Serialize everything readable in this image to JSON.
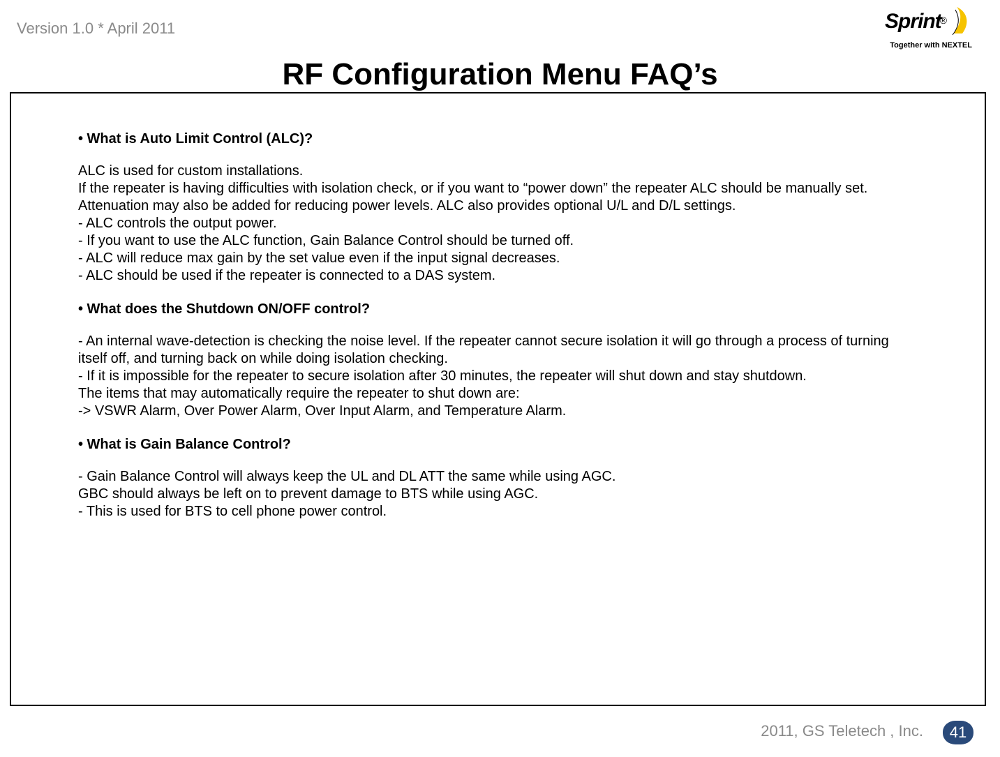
{
  "header": {
    "version_text": "Version 1.0 * April 2011",
    "brand_name": "Sprint",
    "brand_reg": "®",
    "tagline": "Together with NEXTEL"
  },
  "title": "RF Configuration Menu FAQ’s",
  "faq": [
    {
      "question": "• What is Auto Limit Control (ALC)?",
      "answer": "ALC is used for custom installations.\nIf the repeater is having difficulties with isolation check, or if you want to “power down” the repeater ALC should be manually set. Attenuation may also be added for reducing power levels. ALC also provides optional U/L and D/L settings.\n- ALC controls the output power.\n- If you want to use the ALC function, Gain Balance Control should be turned off.\n- ALC will reduce max gain by the set value even if the input signal decreases.\n- ALC should be used if the repeater is connected to a DAS system."
    },
    {
      "question": "• What does the Shutdown ON/OFF control?",
      "answer": "- An internal wave-detection is checking the noise level. If the repeater cannot secure isolation it will go through a process of turning itself off, and turning back on while doing isolation checking.\n- If it is impossible for the repeater to secure isolation after 30 minutes, the repeater will shut down and stay shutdown.\nThe items that may automatically require the repeater to shut down are:\n-> VSWR Alarm, Over Power Alarm, Over Input Alarm, and Temperature Alarm."
    },
    {
      "question": "• What is Gain Balance Control?",
      "answer": "- Gain Balance Control will always keep the UL and DL ATT the same while using AGC.\nGBC should always be left on to prevent damage to BTS while using AGC.\n- This is used for BTS to cell phone power control."
    }
  ],
  "footer": {
    "copyright": "2011, GS Teletech , Inc.",
    "page_number": "41"
  },
  "colors": {
    "muted_text": "#8a8a8a",
    "badge_bg": "#2a4a7a",
    "swoosh": "#f6c300"
  }
}
